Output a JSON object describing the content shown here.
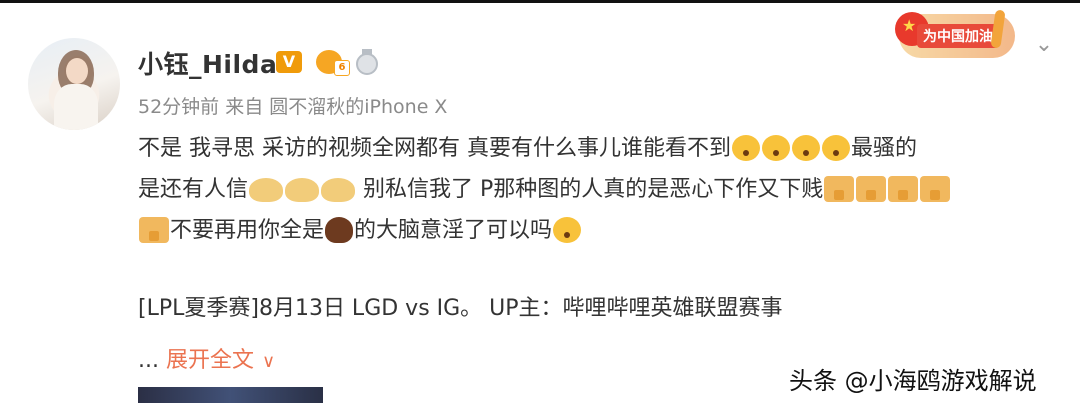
{
  "post": {
    "username": "小钰_Hilda",
    "vip_badge": "V",
    "fan_badge_num": "6",
    "meta": "52分钟前 来自 圆不溜秋的iPhone X",
    "promo_label": "为中国加油",
    "content": {
      "line1_a": "不是 我寻思 采访的视频全网都有 真要有什么事儿谁能看不到",
      "line1_b": "最骚的",
      "line2_a": "是还有人信",
      "line2_b": " 别私信我了 P那种图的人真的是恶心下作又下贱",
      "line3_a": "不要再用你全是",
      "line3_b": "的大脑意淫了可以吗"
    },
    "link_text": "[LPL夏季赛]8月13日 LGD vs IG。 UP主：哔哩哔哩英雄联盟赛事",
    "expand": {
      "dots": "... ",
      "label": "展开全文",
      "arrow": "∨"
    }
  },
  "watermark": "头条 @小海鸥游戏解说",
  "icons": {
    "chevron": "chevron-down-icon",
    "emoji_face": "surprised-face-icon",
    "emoji_pray": "pray-icon",
    "emoji_thumbs_down": "thumbs-down-icon",
    "emoji_poop": "poop-icon"
  }
}
